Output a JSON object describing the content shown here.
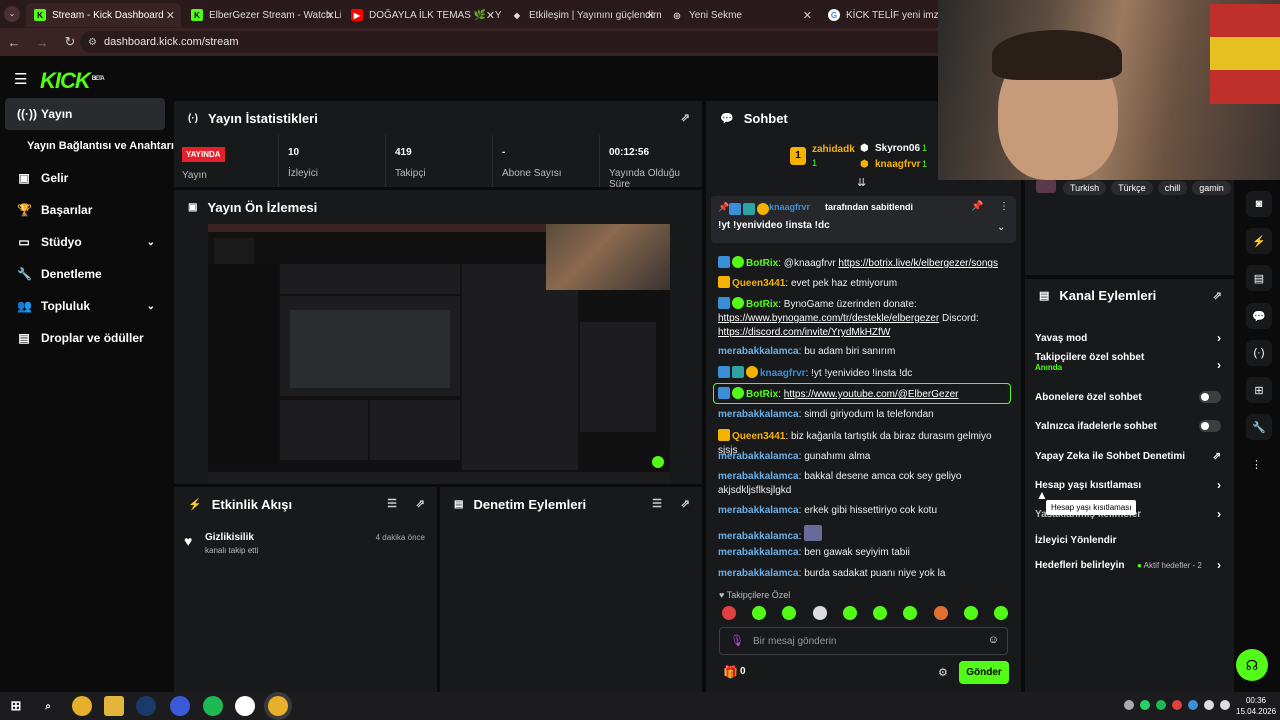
{
  "browser": {
    "tabs": [
      {
        "label": "Stream - Kick Dashboard",
        "icon": "kick-icon",
        "active": true
      },
      {
        "label": "ElberGezer Stream - Watch Live",
        "icon": "kick-icon"
      },
      {
        "label": "DOĞAYLA İLK TEMAS 🌿 - You",
        "icon": "youtube-icon"
      },
      {
        "label": "Etkileşim | Yayınını güçlendirme",
        "icon": "botrix-icon"
      },
      {
        "label": "Yeni Sekme",
        "icon": "globe-icon"
      },
      {
        "label": "KİCK TELİF yeni imzalandı - Go",
        "icon": "google-icon"
      }
    ],
    "url": "dashboard.kick.com/stream"
  },
  "app": {
    "logo": "KICK",
    "logo_badge": "BETA"
  },
  "sidebar": {
    "items": [
      {
        "label": "Yayın",
        "icon": "broadcast-icon"
      },
      {
        "label": "Yayın Bağlantısı ve Anahtarı",
        "icon": ""
      },
      {
        "label": "Gelir",
        "icon": "wallet-icon"
      },
      {
        "label": "Başarılar",
        "icon": "trophy-icon"
      },
      {
        "label": "Stüdyo",
        "icon": "studio-icon"
      },
      {
        "label": "Denetleme",
        "icon": "wrench-icon"
      },
      {
        "label": "Topluluk",
        "icon": "community-icon"
      },
      {
        "label": "Droplar ve ödüller",
        "icon": "drops-icon"
      }
    ]
  },
  "stats": {
    "title": "Yayın İstatistikleri",
    "live_badge": "YAYINDA",
    "live_label": "Yayın",
    "items": [
      {
        "value": "10",
        "label": "İzleyici"
      },
      {
        "value": "419",
        "label": "Takipçi"
      },
      {
        "value": "-",
        "label": "Abone Sayısı"
      },
      {
        "value": "00:12:56",
        "label": "Yayında Olduğu Süre"
      }
    ]
  },
  "preview": {
    "title": "Yayın Ön İzlemesi"
  },
  "activity": {
    "title": "Etkinlik Akışı",
    "events": [
      {
        "user": "Gizlikisilik",
        "text": "kanalı takip etti",
        "time": "4 dakika önce"
      }
    ]
  },
  "moderation": {
    "title": "Denetim Eylemleri"
  },
  "chat": {
    "title": "Sohbet",
    "top_users": [
      {
        "rank": "1",
        "name": "zahidadk",
        "count": "1"
      },
      {
        "name": "Skyron06",
        "count": "1"
      },
      {
        "name": "knaagfrvr",
        "count": "1"
      }
    ],
    "pinned_by": "knaagfrvr",
    "pinned_suffix": "tarafından sabitlendi",
    "pinned_text": "!yt !yenivideo !insta !dc",
    "messages": [
      {
        "user": "BotRix",
        "text": "@knaagfrvr",
        "link": "https://botrix.live/k/elbergezer/songs"
      },
      {
        "user": "Queen3441",
        "text": "evet pek haz etmiyorum"
      },
      {
        "user": "BotRix",
        "text": "BynoGame üzerinden donate:",
        "link": "https://www.bynogame.com/tr/destekle/elbergezer",
        "text2": "Discord:",
        "link2": "https://discord.com/invite/YrydMkHZfW"
      },
      {
        "user": "merabakkalamca",
        "text": "bu adam biri sanırım"
      },
      {
        "user": "knaagfrvr",
        "text": "!yt !yenivideo !insta !dc"
      },
      {
        "user": "BotRix",
        "link": "https://www.youtube.com/@ElberGezer"
      },
      {
        "user": "merabakkalamca",
        "text": "simdi giriyodum la telefondan"
      },
      {
        "user": "Queen3441",
        "text": "biz kağanla tartıştık da biraz durasım gelmiyo sjsjs"
      },
      {
        "user": "merabakkalamca",
        "text": "gunahımı alma"
      },
      {
        "user": "merabakkalamca",
        "text": "bakkal desene amca cok sey geliyo akjsdkljsflksjlgkd"
      },
      {
        "user": "merabakkalamca",
        "text": "erkek gibi hissettiriyo cok kotu"
      },
      {
        "user": "merabakkalamca",
        "text": ""
      },
      {
        "user": "merabakkalamca",
        "text": "ben gawak seyiyim tabii"
      },
      {
        "user": "merabakkalamca",
        "text": "burda sadakat puanı niye yok la"
      }
    ],
    "follower_label": "Takipçilere Özel",
    "input_placeholder": "Bir mesaj gönderin",
    "points": "0",
    "send_label": "Gönder"
  },
  "tags": [
    "Turkish",
    "Türkçe",
    "chill",
    "gamin"
  ],
  "channel_actions": {
    "title": "Kanal Eylemleri",
    "rows": [
      {
        "label": "Yavaş mod",
        "control": "chevron"
      },
      {
        "label": "Takipçilere özel sohbet",
        "sub": "Anında",
        "control": "chevron"
      },
      {
        "label": "Abonelere özel sohbet",
        "control": "toggle"
      },
      {
        "label": "Yalnızca ifadelerle sohbet",
        "control": "toggle"
      },
      {
        "label": "Yapay Zeka ile Sohbet Denetimi",
        "control": "external"
      },
      {
        "label": "Hesap yaşı kısıtlaması",
        "control": "chevron"
      },
      {
        "label": "Yasaklanmış kelimeler",
        "control": "chevron"
      },
      {
        "label": "İzleyici Yönlendir",
        "control": "none"
      },
      {
        "label": "Hedefleri belirleyin",
        "extra": "Aktif hedefler - 2",
        "control": "chevron"
      }
    ],
    "tooltip": "Hesap yaşı kısıtlaması"
  },
  "taskbar": {
    "time": "00:36",
    "date": "15.04.2026"
  },
  "colors": {
    "brand": "#53fc18",
    "live": "#e5202a",
    "panel": "#18191b",
    "bg": "#0b0b0c"
  }
}
